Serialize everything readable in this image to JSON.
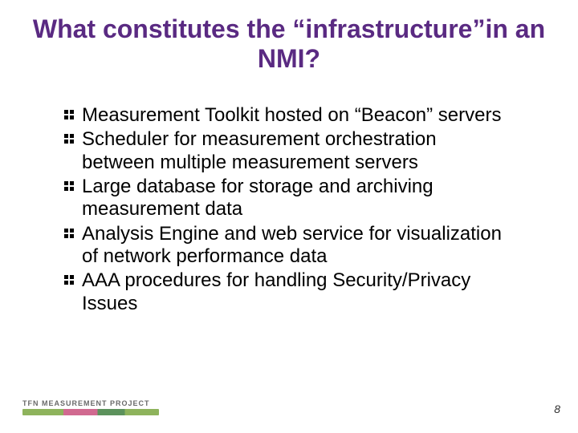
{
  "title": "What constitutes the “infrastructure”in an NMI?",
  "bullets": [
    "Measurement Toolkit hosted on “Beacon” servers",
    "Scheduler for measurement orchestration between multiple measurement servers",
    "Large database for storage and archiving measurement data",
    "Analysis Engine and web service for visualization of network performance data",
    "AAA procedures for handling Security/Privacy Issues"
  ],
  "footer": {
    "brand": "TFN MEASUREMENT PROJECT"
  },
  "page_number": "8",
  "colors": {
    "title": "#5a2a82"
  }
}
